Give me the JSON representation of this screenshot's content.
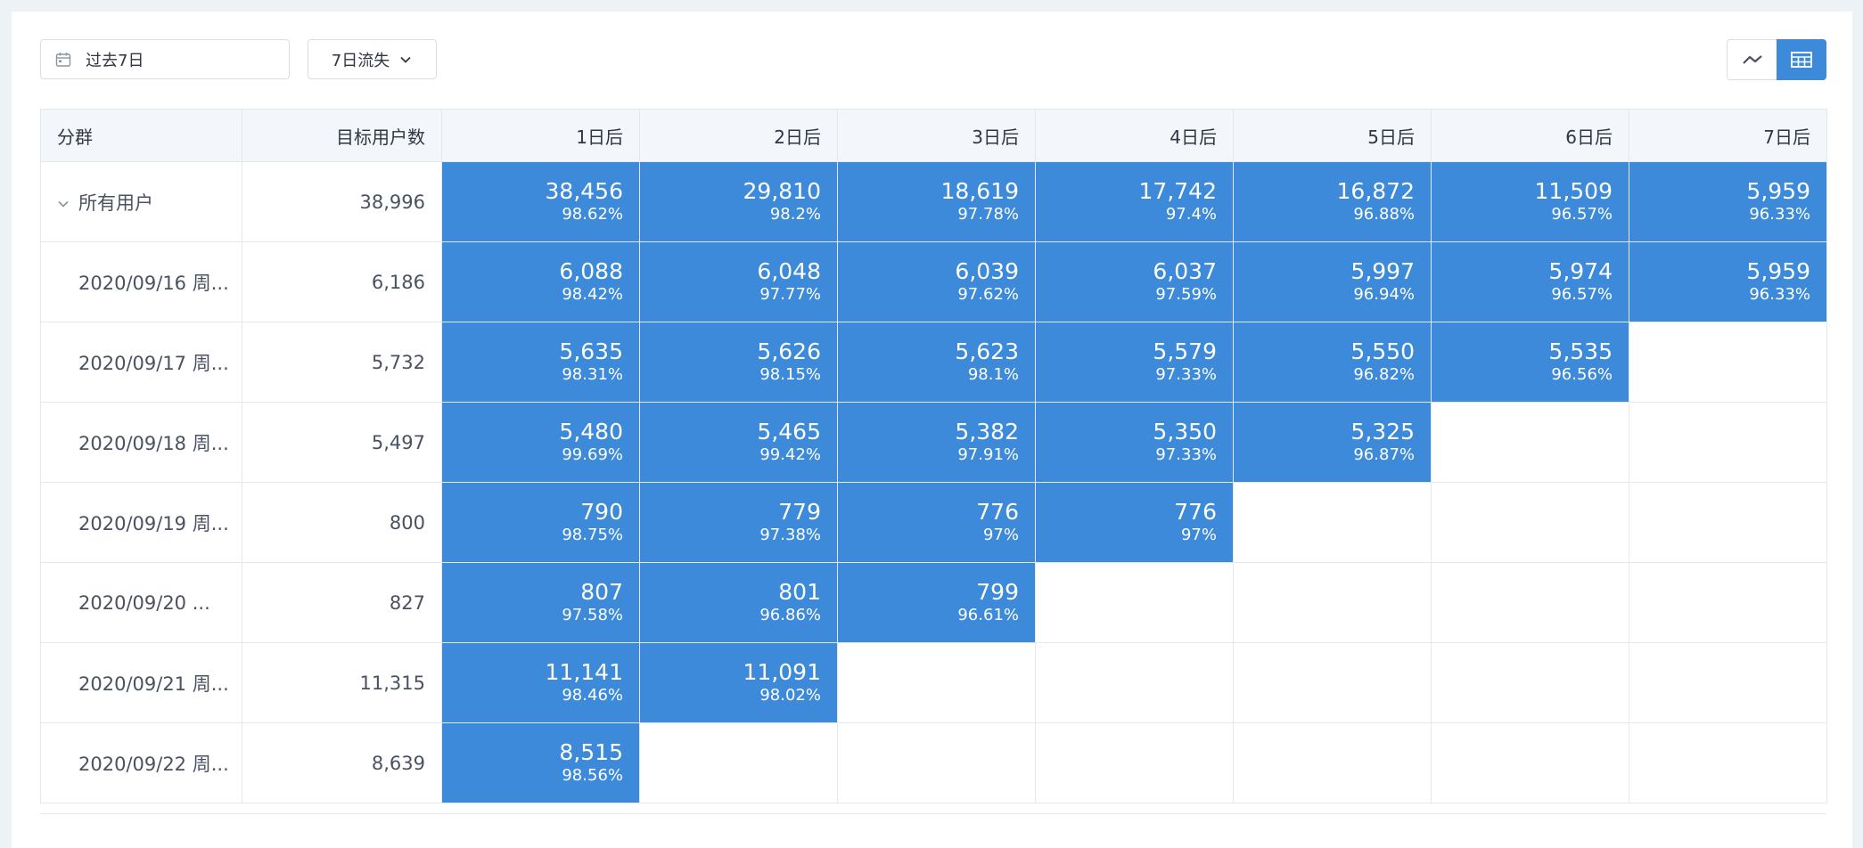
{
  "toolbar": {
    "date_range": "过去7日",
    "metric": "7日流失"
  },
  "table": {
    "headers": [
      "分群",
      "目标用户数",
      "1日后",
      "2日后",
      "3日后",
      "4日后",
      "5日后",
      "6日后",
      "7日后"
    ],
    "rows": [
      {
        "segment": "所有用户",
        "target": "38,996",
        "cells": [
          {
            "n": "38,456",
            "p": "98.62%"
          },
          {
            "n": "29,810",
            "p": "98.2%"
          },
          {
            "n": "18,619",
            "p": "97.78%"
          },
          {
            "n": "17,742",
            "p": "97.4%"
          },
          {
            "n": "16,872",
            "p": "96.88%"
          },
          {
            "n": "11,509",
            "p": "96.57%"
          },
          {
            "n": "5,959",
            "p": "96.33%"
          }
        ]
      },
      {
        "segment": "2020/09/16 周...",
        "target": "6,186",
        "cells": [
          {
            "n": "6,088",
            "p": "98.42%"
          },
          {
            "n": "6,048",
            "p": "97.77%"
          },
          {
            "n": "6,039",
            "p": "97.62%"
          },
          {
            "n": "6,037",
            "p": "97.59%"
          },
          {
            "n": "5,997",
            "p": "96.94%"
          },
          {
            "n": "5,974",
            "p": "96.57%"
          },
          {
            "n": "5,959",
            "p": "96.33%"
          }
        ]
      },
      {
        "segment": "2020/09/17 周...",
        "target": "5,732",
        "cells": [
          {
            "n": "5,635",
            "p": "98.31%"
          },
          {
            "n": "5,626",
            "p": "98.15%"
          },
          {
            "n": "5,623",
            "p": "98.1%"
          },
          {
            "n": "5,579",
            "p": "97.33%"
          },
          {
            "n": "5,550",
            "p": "96.82%"
          },
          {
            "n": "5,535",
            "p": "96.56%"
          }
        ]
      },
      {
        "segment": "2020/09/18 周...",
        "target": "5,497",
        "cells": [
          {
            "n": "5,480",
            "p": "99.69%"
          },
          {
            "n": "5,465",
            "p": "99.42%"
          },
          {
            "n": "5,382",
            "p": "97.91%"
          },
          {
            "n": "5,350",
            "p": "97.33%"
          },
          {
            "n": "5,325",
            "p": "96.87%"
          }
        ]
      },
      {
        "segment": "2020/09/19 周...",
        "target": "800",
        "cells": [
          {
            "n": "790",
            "p": "98.75%"
          },
          {
            "n": "779",
            "p": "97.38%"
          },
          {
            "n": "776",
            "p": "97%"
          },
          {
            "n": "776",
            "p": "97%"
          }
        ]
      },
      {
        "segment": "2020/09/20 ...",
        "target": "827",
        "cells": [
          {
            "n": "807",
            "p": "97.58%"
          },
          {
            "n": "801",
            "p": "96.86%"
          },
          {
            "n": "799",
            "p": "96.61%"
          }
        ]
      },
      {
        "segment": "2020/09/21 周...",
        "target": "11,315",
        "cells": [
          {
            "n": "11,141",
            "p": "98.46%"
          },
          {
            "n": "11,091",
            "p": "98.02%"
          }
        ]
      },
      {
        "segment": "2020/09/22 周...",
        "target": "8,639",
        "cells": [
          {
            "n": "8,515",
            "p": "98.56%"
          }
        ]
      }
    ]
  },
  "colors": {
    "cell_fill": "#3d8ada",
    "header_bg": "#f3f6fa",
    "page_bg": "#edf2f7"
  }
}
